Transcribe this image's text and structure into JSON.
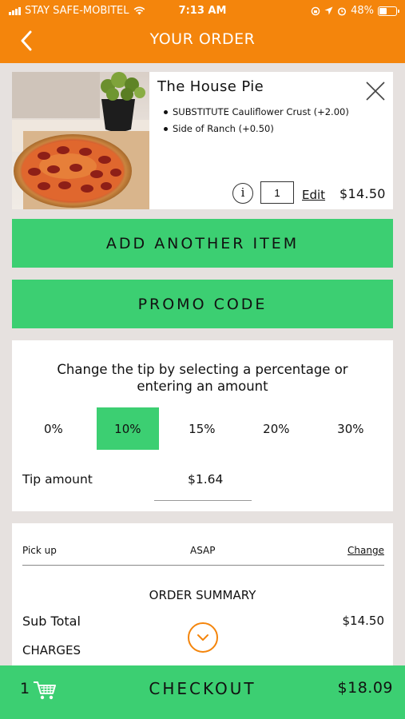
{
  "status_bar": {
    "carrier": "STAY SAFE-MOBITEL",
    "time": "7:13 AM",
    "battery_text": "48%",
    "battery_level": 0.48
  },
  "header": {
    "title": "YOUR ORDER",
    "back_icon": "chevron-left-icon",
    "accent_color": "#f4850c"
  },
  "cart_item": {
    "name": "The House Pie",
    "modifiers": [
      "SUBSTITUTE Cauliflower Crust (+2.00)",
      "Side of Ranch (+0.50)"
    ],
    "info_symbol": "i",
    "quantity": "1",
    "edit_label": "Edit",
    "price": "$14.50",
    "photo": "pepperoni-pizza-photo"
  },
  "actions": {
    "add_item_label": "ADD ANOTHER ITEM",
    "promo_label": "PROMO CODE",
    "button_color": "#3ccf72"
  },
  "tip": {
    "prompt": "Change the tip by selecting a percentage or entering an amount",
    "options": [
      "0%",
      "10%",
      "15%",
      "20%",
      "30%"
    ],
    "selected": "10%",
    "amount_label": "Tip amount",
    "amount_value": "$1.64"
  },
  "summary": {
    "pickup_label": "Pick up",
    "pickup_time": "ASAP",
    "change_label": "Change",
    "title": "ORDER SUMMARY",
    "subtotal_label": "Sub Total",
    "subtotal_value": "$14.50",
    "charges_label": "CHARGES",
    "expand_icon": "chevron-down-icon"
  },
  "checkout": {
    "item_count": "1",
    "cart_icon": "shopping-cart-icon",
    "label": "CHECKOUT",
    "total": "$18.09"
  }
}
